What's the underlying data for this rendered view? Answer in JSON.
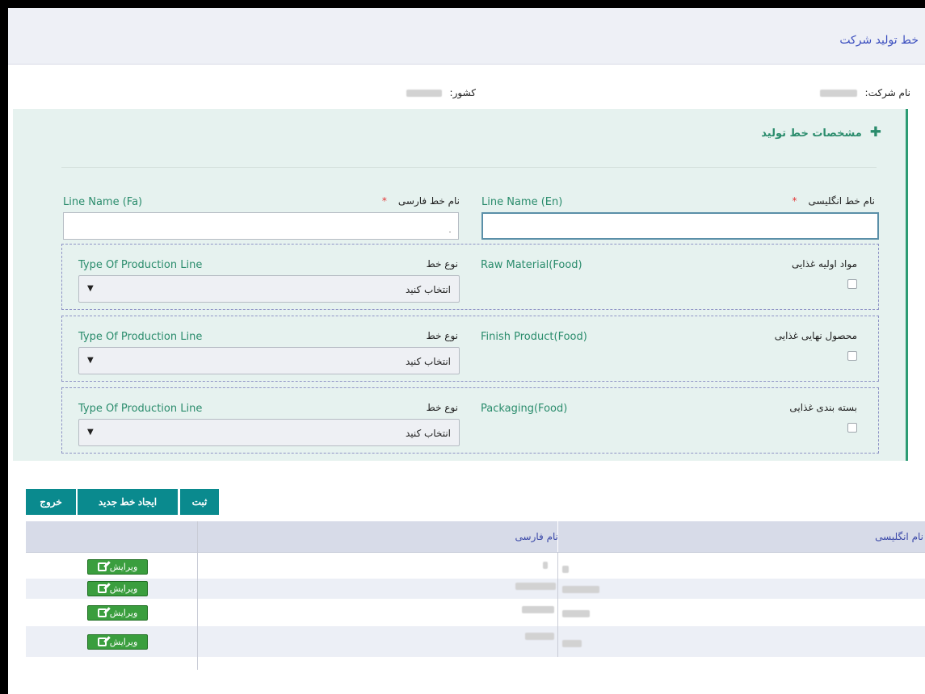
{
  "header": {
    "title": "خط تولید شرکت"
  },
  "meta": {
    "company_label": "نام شرکت:",
    "country_label": "کشور:"
  },
  "panel": {
    "title": "مشخصات خط تولید",
    "fields": {
      "fa_name_label": "نام خط فارسی",
      "fa_name_en_label": "Line Name (Fa)",
      "en_name_label": "نام خط انگلیسی",
      "en_name_en_label": "Line Name (En)",
      "required_mark": "*"
    },
    "groups": [
      {
        "checkbox_label": "مواد اولیه غذایی",
        "en_label": "Raw Material(Food)",
        "type_label": "نوع خط",
        "type_en_label": "Type Of Production Line",
        "select_value": "انتخاب کنید"
      },
      {
        "checkbox_label": "محصول نهایی غذایی",
        "en_label": "Finish Product(Food)",
        "type_label": "نوع خط",
        "type_en_label": "Type Of Production Line",
        "select_value": "انتخاب کنید"
      },
      {
        "checkbox_label": "بسته بندی غذایی",
        "en_label": "Packaging(Food)",
        "type_label": "نوع خط",
        "type_en_label": "Type Of Production Line",
        "select_value": "انتخاب کنید"
      }
    ]
  },
  "buttons": {
    "submit": "ثبت",
    "new_line": "ایجاد خط جدید",
    "exit": "خروج"
  },
  "grid": {
    "columns": [
      "نام انگلیسی",
      "نام فارسی",
      ""
    ],
    "edit_label": "ویرایش",
    "row_count_shown": 4
  },
  "colors": {
    "accent": "#2a8c6c",
    "button": "#0a8a8e",
    "edit": "#3a9e3e",
    "link": "#3c4fbf"
  }
}
